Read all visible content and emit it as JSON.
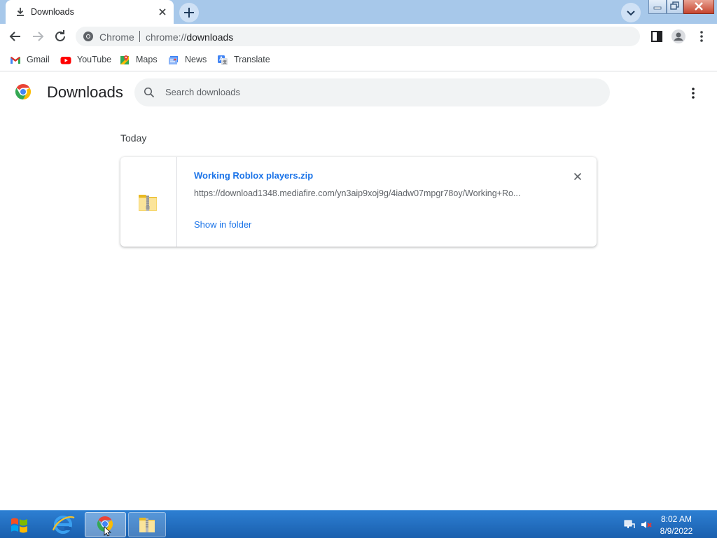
{
  "colors": {
    "accent": "#1a73e8",
    "tabstrip": "#a7c8ea",
    "taskbar": "#1a5fae"
  },
  "browser": {
    "tab": {
      "title": "Downloads",
      "icon": "download-icon"
    },
    "omnibox": {
      "security_label": "Chrome",
      "url_scheme": "chrome://",
      "url_path": "downloads"
    }
  },
  "bookmarks": [
    {
      "label": "Gmail",
      "icon": "gmail-icon"
    },
    {
      "label": "YouTube",
      "icon": "youtube-icon"
    },
    {
      "label": "Maps",
      "icon": "maps-icon"
    },
    {
      "label": "News",
      "icon": "news-icon"
    },
    {
      "label": "Translate",
      "icon": "translate-icon"
    }
  ],
  "page": {
    "title": "Downloads",
    "search_placeholder": "Search downloads",
    "group_label": "Today",
    "downloads": [
      {
        "file_name": "Working Roblox players.zip",
        "url": "https://download1348.mediafire.com/yn3aip9xoj9g/4iadw07mpgr78oy/Working+Ro...",
        "action": "Show in folder",
        "icon": "zip-folder-icon"
      }
    ]
  },
  "taskbar": {
    "items": [
      "start-button",
      "internet-explorer",
      "chrome",
      "file-explorer"
    ],
    "time": "8:02 AM",
    "date": "8/9/2022"
  }
}
